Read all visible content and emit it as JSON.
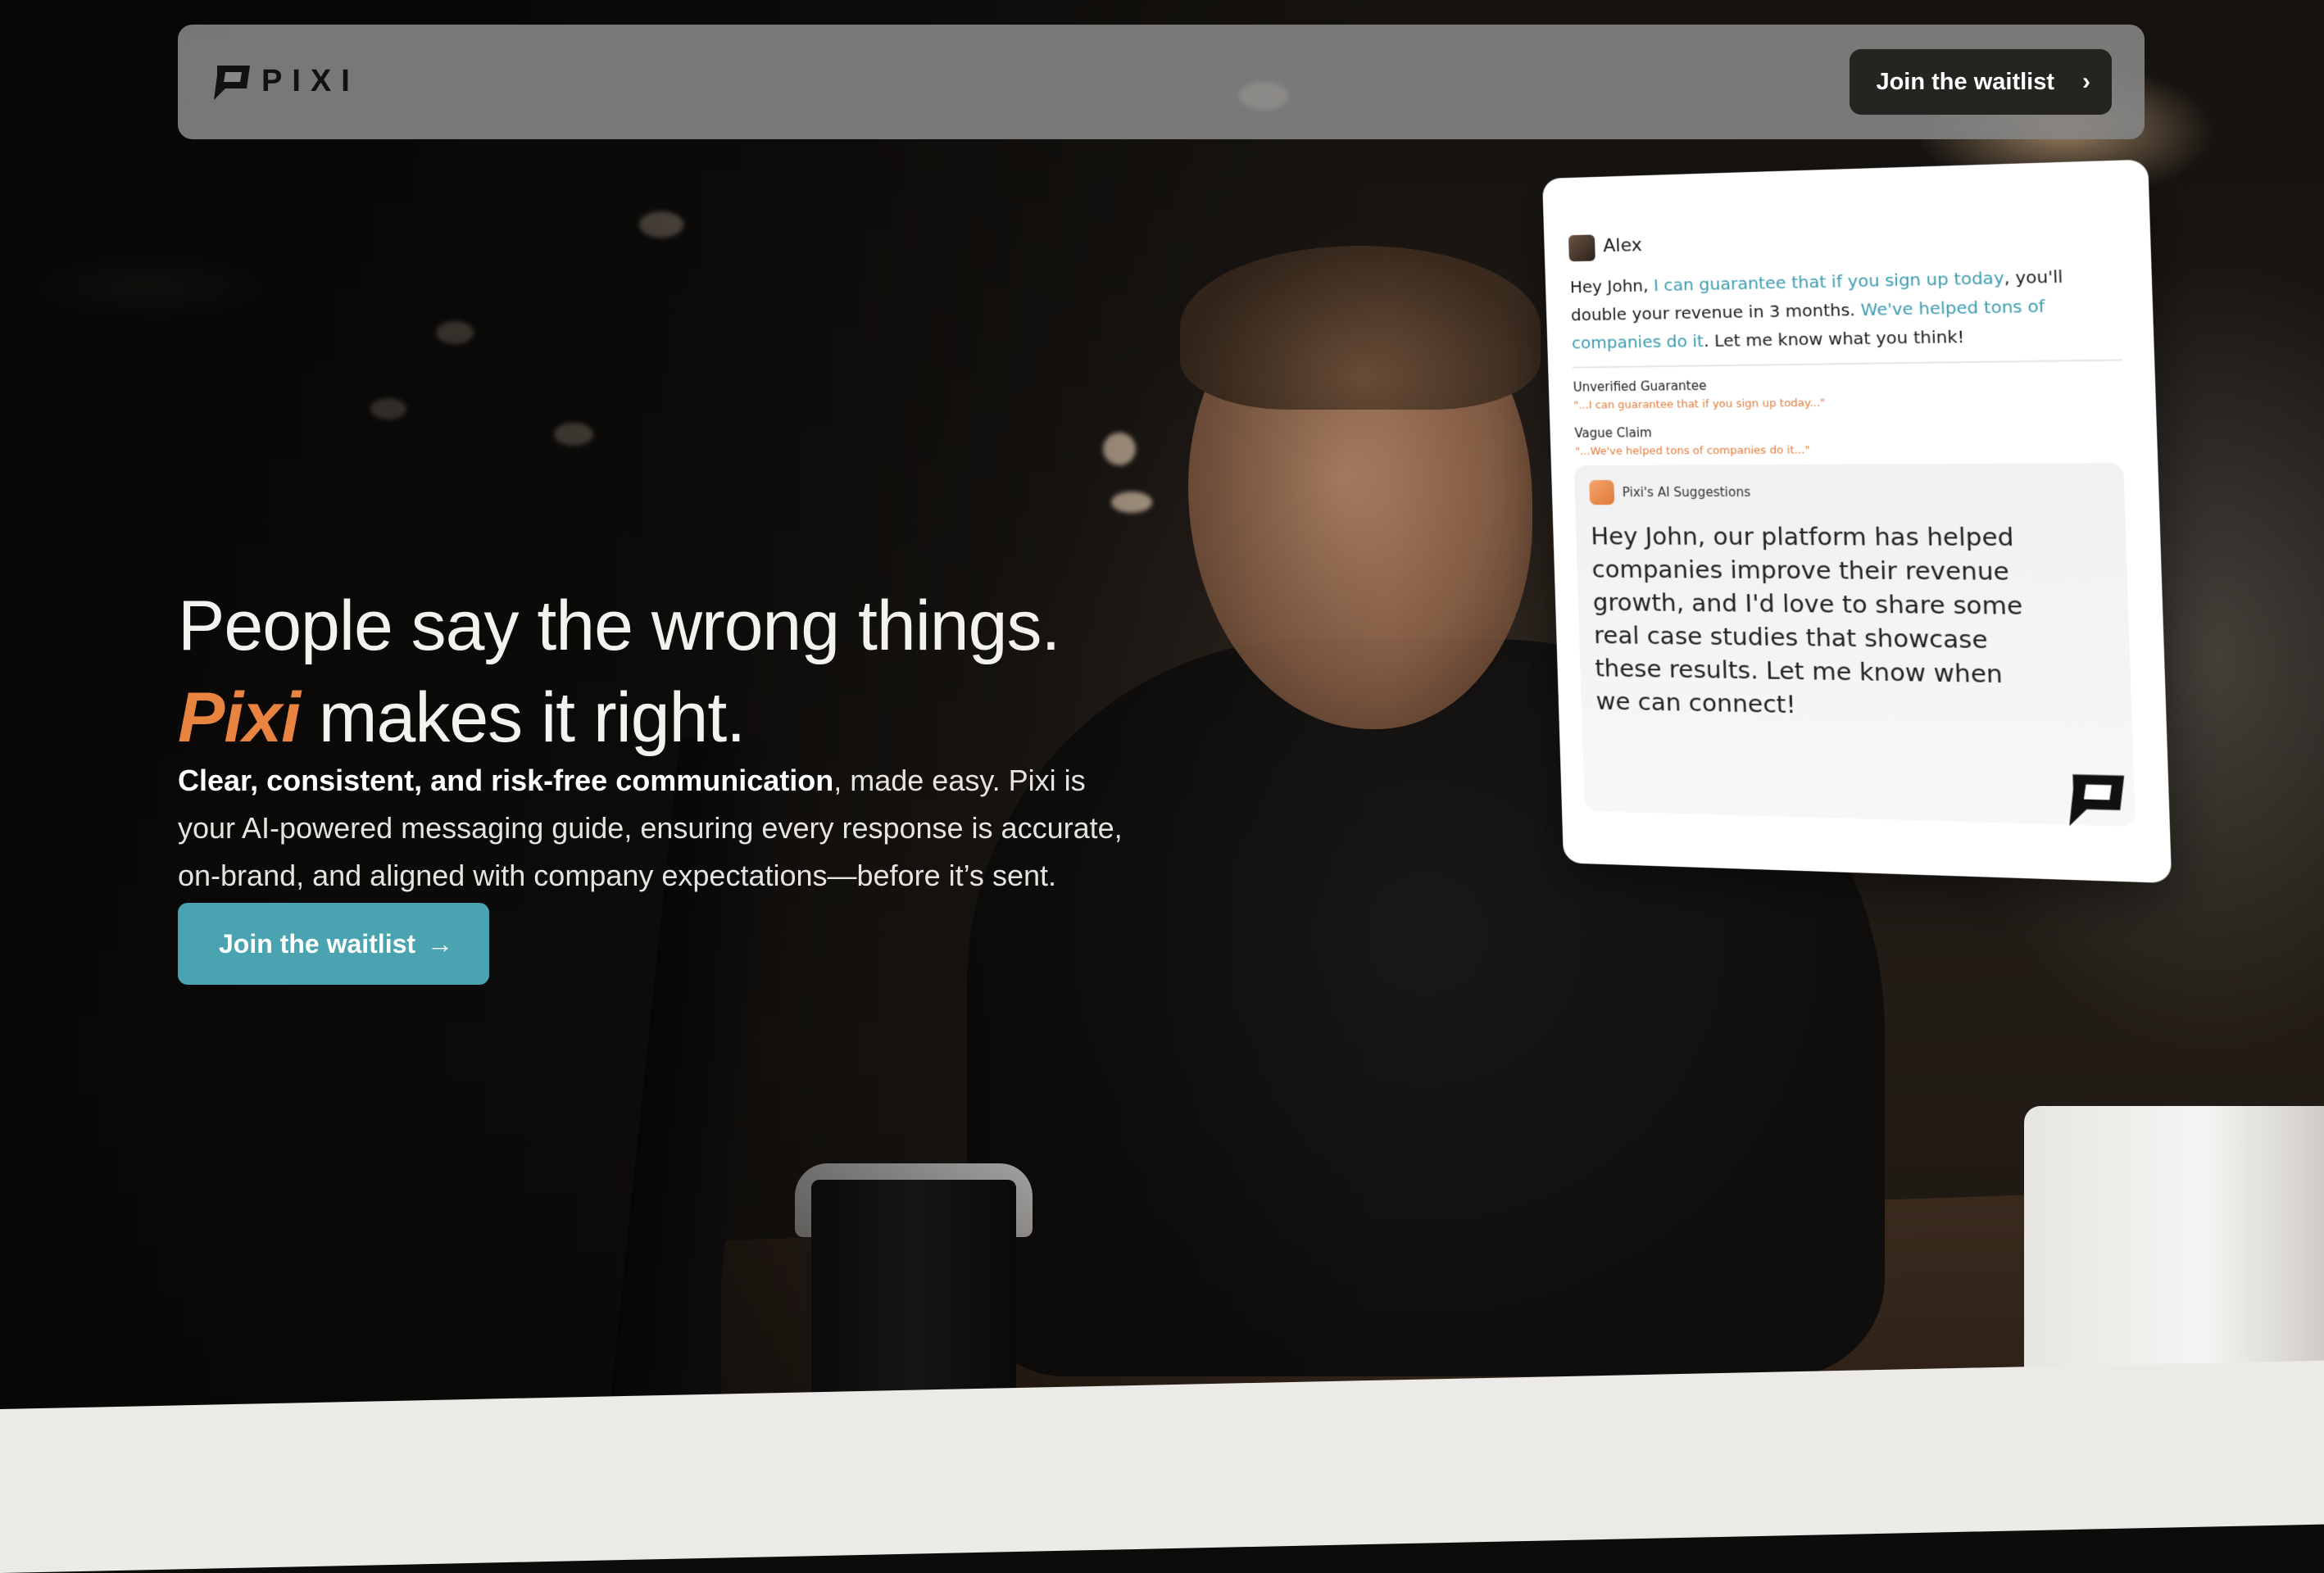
{
  "navbar": {
    "brand": "PIXI",
    "cta_label": "Join the waitlist",
    "cta_icon": "chevron-right-icon"
  },
  "hero": {
    "headline_line1": "People say the wrong things.",
    "headline_brand": "Pixi",
    "headline_line2_rest": " makes it right.",
    "subcopy_bold": "Clear, consistent, and risk-free communication",
    "subcopy_rest": ", made easy. Pixi is your AI-powered messaging guide, ensuring every response is accurate, on-brand, and aligned with company expectations—before it’s sent.",
    "cta_label": "Join the waitlist",
    "cta_icon": "arrow-right-icon"
  },
  "card": {
    "sender": "Alex",
    "message_parts": {
      "p1": "Hey John, ",
      "h1": "I can guarantee that if you sign up today",
      "p2": ", you'll double your revenue in 3 months. ",
      "h2": "We've helped tons of companies do it",
      "p3": ". Let me know what you think!"
    },
    "flags": [
      {
        "title": "Unverified Guarantee",
        "quote": "\"...I can guarantee that if you sign up today...\""
      },
      {
        "title": "Vague Claim",
        "quote": "\"...We've helped tons of companies do it...\""
      }
    ],
    "suggestion_label": "Pixi's AI Suggestions",
    "suggestion_text": "Hey John, our platform has helped companies improve their revenue growth, and I'd love to share some real case studies that showcase these results. Let me know when we can connect!"
  },
  "colors": {
    "accent_orange": "#e8843f",
    "accent_teal": "#4aa3b1",
    "highlight_blue": "#3b9bb0"
  }
}
